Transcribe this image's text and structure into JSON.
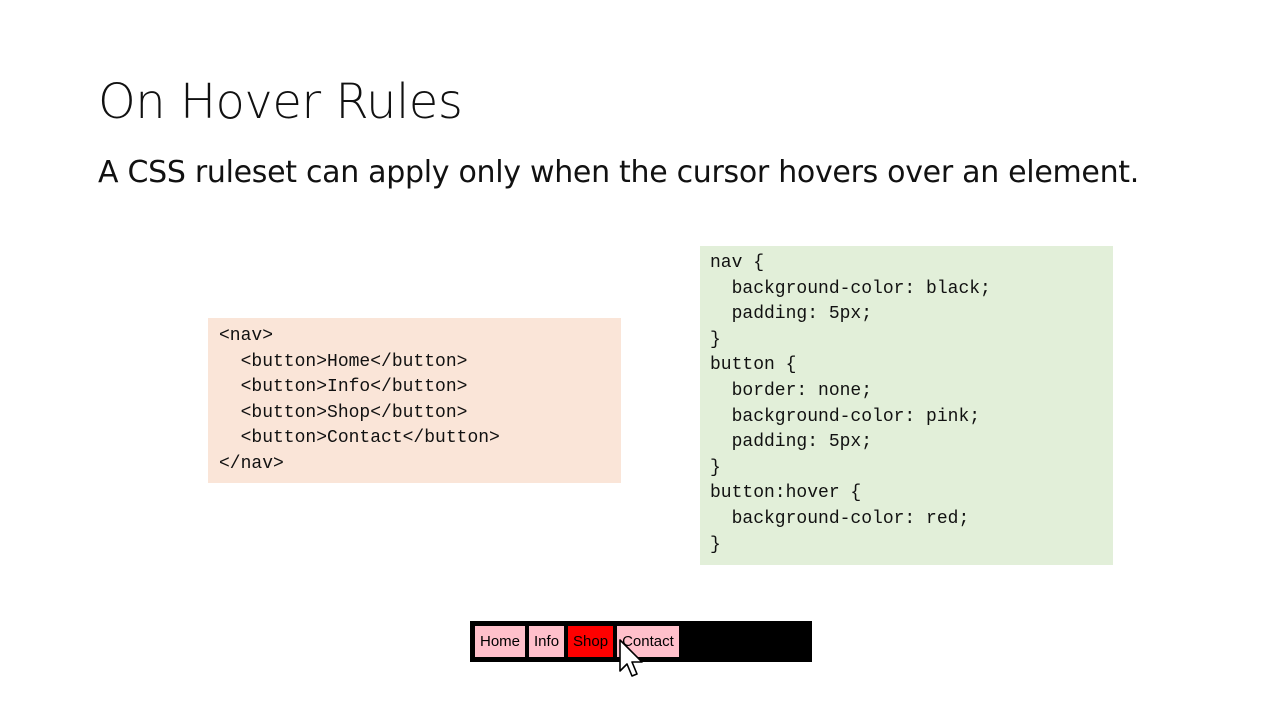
{
  "slide": {
    "title": "On Hover Rules",
    "subtitle": "A CSS ruleset can apply only when the cursor hovers over an element."
  },
  "html_code": "<nav>\n  <button>Home</button>\n  <button>Info</button>\n  <button>Shop</button>\n  <button>Contact</button>\n</nav>",
  "css_code": "nav {\n  background-color: black;\n  padding: 5px;\n}\nbutton {\n  border: none;\n  background-color: pink;\n  padding: 5px;\n}\nbutton:hover {\n  background-color: red;\n}",
  "demo": {
    "buttons": [
      "Home",
      "Info",
      "Shop",
      "Contact"
    ],
    "hovered": "Shop",
    "nav_color": "#000000",
    "button_color": "#ffc0cb",
    "hover_color": "#ff0000"
  },
  "cursor_icon": "arrow-pointer-icon"
}
